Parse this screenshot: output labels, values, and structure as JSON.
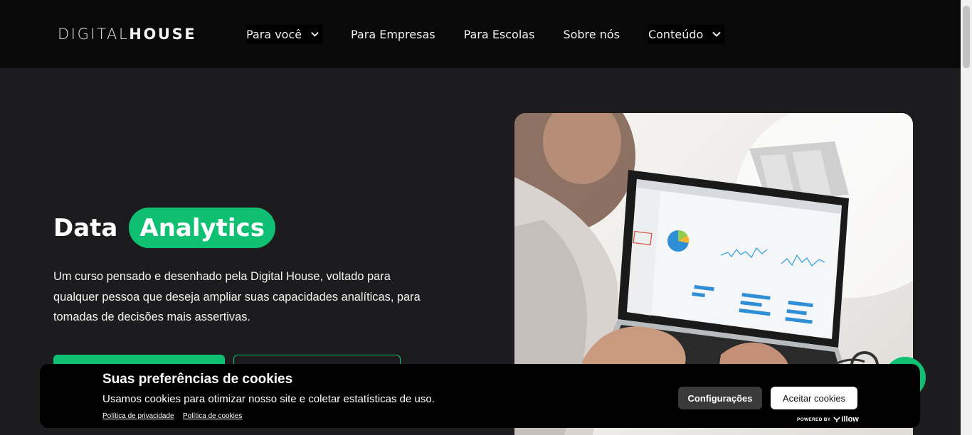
{
  "header": {
    "logo_light": "DIGITAL",
    "logo_bold": "HOUSE",
    "nav": [
      {
        "label": "Para você",
        "dropdown": true
      },
      {
        "label": "Para Empresas",
        "dropdown": false
      },
      {
        "label": "Para Escolas",
        "dropdown": false
      },
      {
        "label": "Sobre nós",
        "dropdown": false
      },
      {
        "label": "Conteúdo",
        "dropdown": true
      }
    ]
  },
  "hero": {
    "title_plain": "Data",
    "title_highlight": "Analytics",
    "description": "Um curso pensado e desenhado pela Digital House, voltado para qualquer pessoa que deseja ampliar suas capacidades analíticas, para tomadas de decisões mais assertivas."
  },
  "cookie_banner": {
    "title": "Suas preferências de cookies",
    "text": "Usamos cookies para otimizar nosso site e coletar estatísticas de uso.",
    "privacy_link": "Política de privacidade",
    "cookies_link": "Política de cookies",
    "config_button": "Configurações",
    "accept_button": "Aceitar cookies",
    "powered_by": "POWERED BY",
    "powered_brand": "illow"
  },
  "colors": {
    "accent": "#0fbf72",
    "header_bg": "#090909",
    "page_bg": "#1c1c1e"
  },
  "icons": {
    "nav_dropdown": "chevron-down-icon",
    "floating_button": "whatsapp-icon",
    "brand": "illow-logo-icon"
  }
}
